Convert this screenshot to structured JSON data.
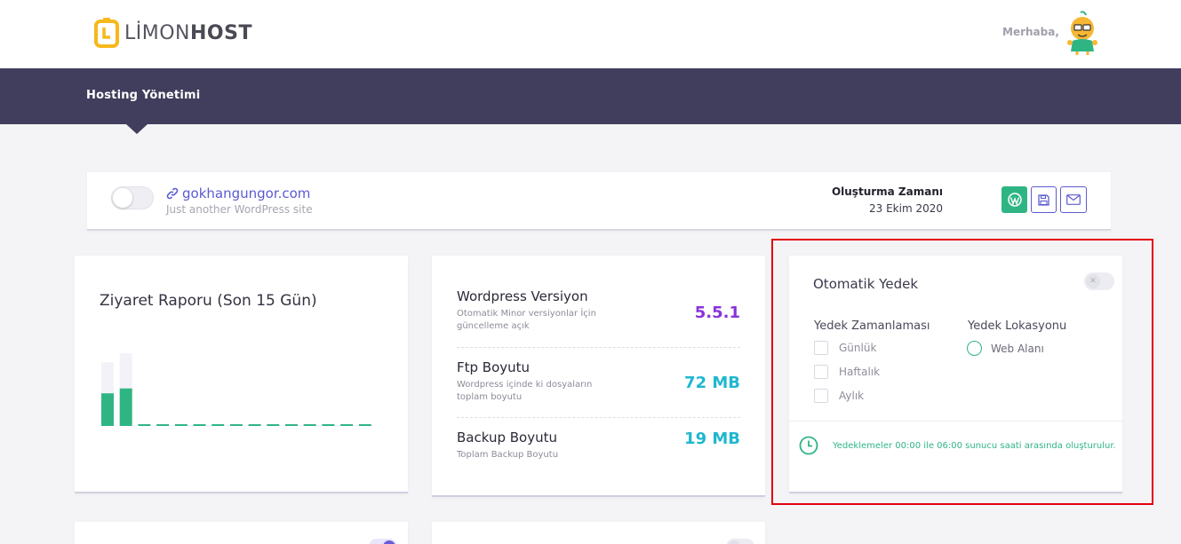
{
  "brand": {
    "name_light": "LİMON",
    "name_bold": "HOST",
    "accent": "#f6b81c"
  },
  "header": {
    "greeting": "Merhaba,"
  },
  "nav": {
    "items": [
      "Hosting Yönetimi"
    ]
  },
  "site": {
    "domain": "gokhangungor.com",
    "tagline": "Just another WordPress site",
    "created_label": "Oluşturma Zamanı",
    "created_value": "23 Ekim 2020",
    "actions": [
      "wordpress-icon",
      "save-icon",
      "mail-icon"
    ]
  },
  "visit_report": {
    "title": "Ziyaret Raporu (Son 15 Gün)",
    "bars": [
      {
        "total": 0.78,
        "value": 0.4
      },
      {
        "total": 0.89,
        "value": 0.46
      },
      {
        "total": 0,
        "value": 0
      },
      {
        "total": 0,
        "value": 0
      },
      {
        "total": 0,
        "value": 0
      },
      {
        "total": 0,
        "value": 0
      },
      {
        "total": 0,
        "value": 0
      },
      {
        "total": 0,
        "value": 0
      },
      {
        "total": 0,
        "value": 0
      },
      {
        "total": 0,
        "value": 0
      },
      {
        "total": 0,
        "value": 0
      },
      {
        "total": 0,
        "value": 0
      },
      {
        "total": 0,
        "value": 0
      },
      {
        "total": 0,
        "value": 0
      },
      {
        "total": 0,
        "value": 0
      }
    ],
    "colors": {
      "value": "#2fb584",
      "total": "#f2f2f8"
    }
  },
  "info": {
    "rows": [
      {
        "title": "Wordpress Versiyon",
        "desc": "Otomatik Minor versiyonlar İçin güncelleme açık",
        "value": "5.5.1"
      },
      {
        "title": "Ftp Boyutu",
        "desc": "Wordpress içinde ki dosyaların toplam boyutu",
        "value": "72 MB"
      },
      {
        "title": "Backup Boyutu",
        "desc": "Toplam Backup Boyutu",
        "value": "19 MB"
      }
    ],
    "colors": {
      "version": "#8a33d9",
      "size": "#1fb7cf"
    }
  },
  "backup": {
    "title": "Otomatik Yedek",
    "schedule_label": "Yedek Zamanlaması",
    "location_label": "Yedek Lokasyonu",
    "schedule_options": [
      "Günlük",
      "Haftalık",
      "Aylık"
    ],
    "location_options": [
      "Web Alanı"
    ],
    "note": "Yedeklemeler 00:00 ile 06:00 sunucu saati arasında oluşturulur.",
    "enabled": false
  }
}
